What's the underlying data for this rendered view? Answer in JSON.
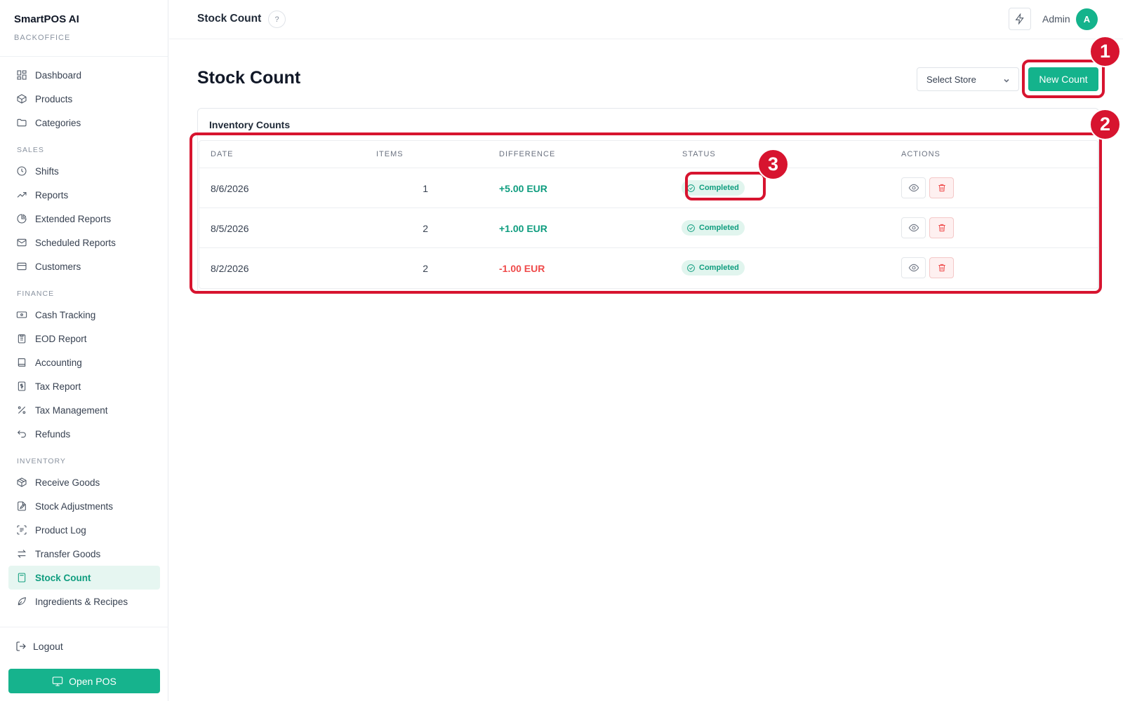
{
  "brand": {
    "name": "SmartPOS AI",
    "subtitle": "BACKOFFICE"
  },
  "sidebar": {
    "sections": [
      {
        "title": "",
        "items": [
          {
            "label": "Dashboard",
            "icon": "dashboard-icon"
          },
          {
            "label": "Products",
            "icon": "box-icon"
          },
          {
            "label": "Categories",
            "icon": "folder-icon"
          }
        ]
      },
      {
        "title": "SALES",
        "items": [
          {
            "label": "Shifts",
            "icon": "clock-icon"
          },
          {
            "label": "Reports",
            "icon": "trending-up-icon"
          },
          {
            "label": "Extended Reports",
            "icon": "pie-chart-icon"
          },
          {
            "label": "Scheduled Reports",
            "icon": "mail-icon"
          },
          {
            "label": "Customers",
            "icon": "credit-card-icon"
          }
        ]
      },
      {
        "title": "FINANCE",
        "items": [
          {
            "label": "Cash Tracking",
            "icon": "banknote-icon"
          },
          {
            "label": "EOD Report",
            "icon": "clipboard-icon"
          },
          {
            "label": "Accounting",
            "icon": "book-icon"
          },
          {
            "label": "Tax Report",
            "icon": "dollar-receipt-icon"
          },
          {
            "label": "Tax Management",
            "icon": "percent-icon"
          },
          {
            "label": "Refunds",
            "icon": "undo-icon"
          }
        ]
      },
      {
        "title": "INVENTORY",
        "items": [
          {
            "label": "Receive Goods",
            "icon": "package-icon"
          },
          {
            "label": "Stock Adjustments",
            "icon": "file-edit-icon"
          },
          {
            "label": "Product Log",
            "icon": "scan-list-icon"
          },
          {
            "label": "Transfer Goods",
            "icon": "arrows-swap-icon"
          },
          {
            "label": "Stock Count",
            "icon": "calculator-icon",
            "active": true
          },
          {
            "label": "Ingredients & Recipes",
            "icon": "leaf-icon"
          }
        ]
      }
    ],
    "logout_label": "Logout",
    "open_pos_label": "Open POS"
  },
  "header": {
    "title": "Stock Count",
    "admin_label": "Admin",
    "avatar_initial": "A"
  },
  "main": {
    "page_title": "Stock Count",
    "select_store_placeholder": "Select Store",
    "new_count_label": "New Count",
    "card_title": "Inventory Counts",
    "columns": [
      "DATE",
      "ITEMS",
      "DIFFERENCE",
      "STATUS",
      "ACTIONS"
    ],
    "rows": [
      {
        "date": "8/6/2026",
        "items": "1",
        "difference": "+5.00 EUR",
        "diff_sign": "positive",
        "status": "Completed"
      },
      {
        "date": "8/5/2026",
        "items": "2",
        "difference": "+1.00 EUR",
        "diff_sign": "positive",
        "status": "Completed"
      },
      {
        "date": "8/2/2026",
        "items": "2",
        "difference": "-1.00 EUR",
        "diff_sign": "negative",
        "status": "Completed"
      }
    ]
  },
  "annotations": {
    "markers": [
      "1",
      "2",
      "3"
    ],
    "color": "#d7142f"
  },
  "colors": {
    "accent": "#14b38c",
    "positive": "#0f9d7f",
    "negative": "#ef4a4a"
  }
}
